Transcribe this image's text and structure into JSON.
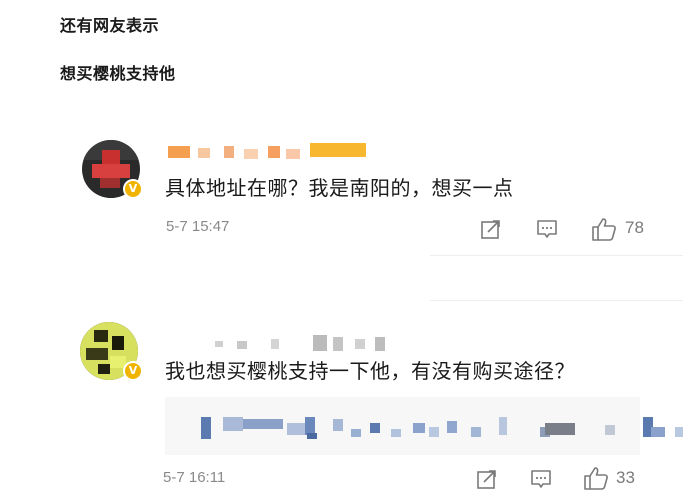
{
  "captions": {
    "line1": "还有网友表示",
    "line2": "想买樱桃支持他"
  },
  "comments": [
    {
      "text": "具体地址在哪？我是南阳的，想买一点",
      "timestamp": "5-7 15:47",
      "likes": "78"
    },
    {
      "text": "我也想买樱桃支持一下他，有没有购买途径？",
      "timestamp": "5-7 16:11",
      "likes": "33"
    }
  ],
  "icons": {
    "verified_badge": "verified-v-icon",
    "share": "share-icon",
    "comment": "comment-icon",
    "like": "thumbs-up-icon"
  },
  "colors": {
    "badge": "#f0b400",
    "text": "#1a1a1a",
    "meta": "#8a8a8a"
  }
}
